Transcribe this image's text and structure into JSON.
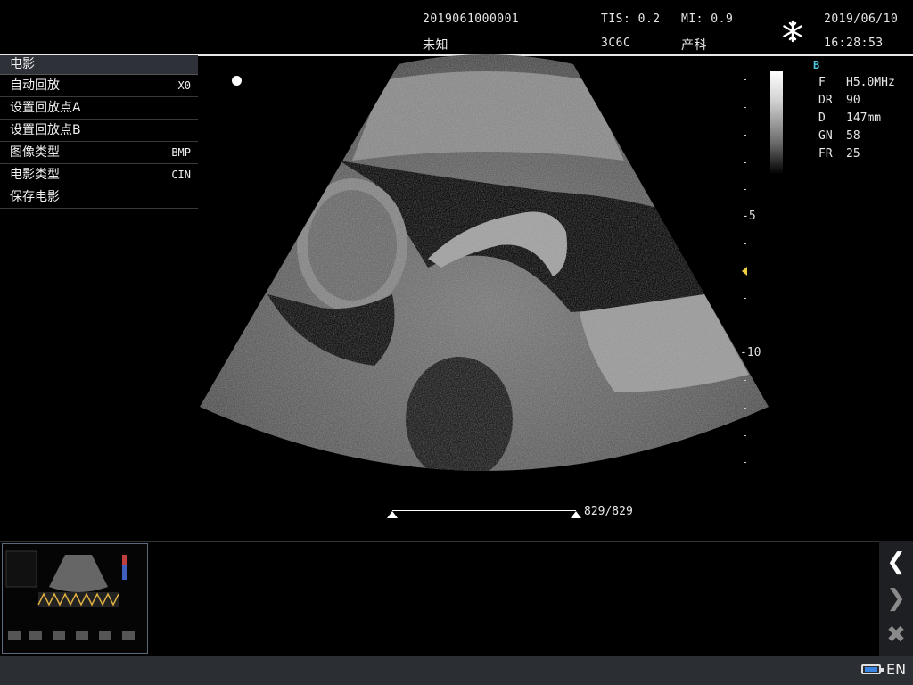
{
  "header": {
    "patient_id": "2019061000001",
    "patient_name": "未知",
    "tis": "TIS: 0.2",
    "probe": "3C6C",
    "mi": "MI: 0.9",
    "exam_type": "产科",
    "date": "2019/06/10",
    "time": "16:28:53",
    "freeze_icon": "snowflake-icon"
  },
  "cine_menu": {
    "title": "电影",
    "items": [
      {
        "label": "自动回放",
        "value": "X0"
      },
      {
        "label": "设置回放点A",
        "value": ""
      },
      {
        "label": "设置回放点B",
        "value": ""
      },
      {
        "label": "图像类型",
        "value": "BMP"
      },
      {
        "label": "电影类型",
        "value": "CIN"
      },
      {
        "label": "保存电影",
        "value": ""
      }
    ]
  },
  "depth_scale": {
    "labels": [
      "-5",
      "-10"
    ],
    "marker": "focus-marker"
  },
  "params": {
    "mode": "B",
    "rows": [
      {
        "key": "F",
        "value": "H5.0MHz"
      },
      {
        "key": "DR",
        "value": "90"
      },
      {
        "key": "D",
        "value": "147mm"
      },
      {
        "key": "GN",
        "value": "58"
      },
      {
        "key": "FR",
        "value": "25"
      }
    ]
  },
  "cine_bar": {
    "counter": "829/829",
    "position": 1.0
  },
  "nav": {
    "prev_icon": "chevron-left-icon",
    "next_icon": "chevron-right-icon",
    "close_icon": "close-icon"
  },
  "status": {
    "language": "EN",
    "battery_icon": "battery-icon"
  },
  "colors": {
    "accent_mode": "#4fc6e0",
    "focus_marker": "#f0d040"
  }
}
